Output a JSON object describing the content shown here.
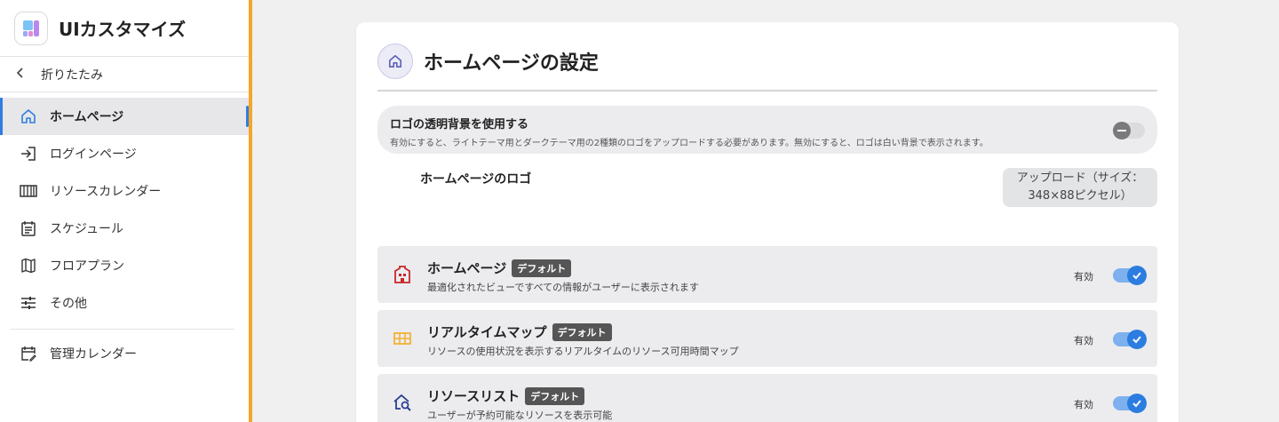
{
  "app": {
    "title": "UIカスタマイズ"
  },
  "sidebar": {
    "collapse_label": "折りたたみ",
    "items": [
      {
        "label": "ホームページ",
        "icon": "home-icon",
        "active": true
      },
      {
        "label": "ログインページ",
        "icon": "login-icon"
      },
      {
        "label": "リソースカレンダー",
        "icon": "resource-calendar-icon"
      },
      {
        "label": "スケジュール",
        "icon": "schedule-icon"
      },
      {
        "label": "フロアプラン",
        "icon": "map-icon"
      },
      {
        "label": "その他",
        "icon": "sliders-icon"
      }
    ],
    "extra_items": [
      {
        "label": "管理カレンダー",
        "icon": "edit-calendar-icon"
      }
    ]
  },
  "main": {
    "title": "ホームページの設定",
    "transparent_bg": {
      "title": "ロゴの透明背景を使用する",
      "desc": "有効にすると、ライトテーマ用とダークテーマ用の2種類のロゴをアップロードする必要があります。無効にすると、ロゴは白い背景で表示されます。",
      "enabled": false
    },
    "logo": {
      "label": "ホームページのロゴ",
      "upload_label_line1": "アップロード（サイズ：",
      "upload_label_line2": "348×88ピクセル）"
    },
    "features": [
      {
        "name": "ホームページ",
        "badge": "デフォルト",
        "desc": "最適化されたビューですべての情報がユーザーに表示されます",
        "state": "有効",
        "enabled": true,
        "icon": "building-icon",
        "icon_color": "#c62828"
      },
      {
        "name": "リアルタイムマップ",
        "badge": "デフォルト",
        "desc": "リソースの使用状況を表示するリアルタイムのリソース可用時間マップ",
        "state": "有効",
        "enabled": true,
        "icon": "grid-map-icon",
        "icon_color": "#f2b233"
      },
      {
        "name": "リソースリスト",
        "badge": "デフォルト",
        "desc": "ユーザーが予約可能なリソースを表示可能",
        "state": "有効",
        "enabled": true,
        "icon": "search-home-icon",
        "icon_color": "#2c3e8f"
      }
    ]
  },
  "colors": {
    "accent": "#2b7de0",
    "sidebar_border": "#f4a62a"
  }
}
